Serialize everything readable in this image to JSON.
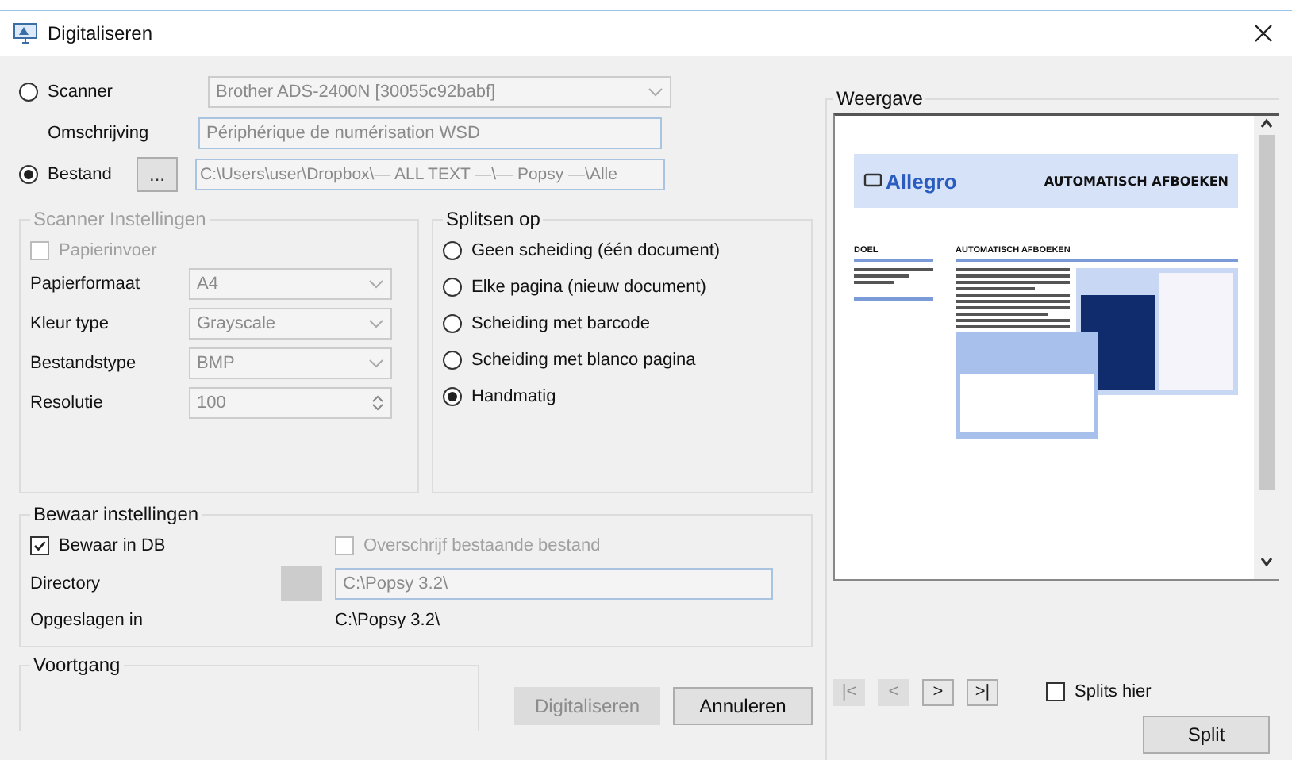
{
  "window": {
    "title": "Digitaliseren"
  },
  "scanner": {
    "label": "Scanner",
    "selected": false,
    "device": "Brother ADS-2400N [30055c92babf]"
  },
  "description": {
    "label": "Omschrijving",
    "value": "Périphérique de numérisation WSD"
  },
  "file": {
    "label": "Bestand",
    "selected": true,
    "browse": "...",
    "path": "C:\\Users\\user\\Dropbox\\— ALL TEXT —\\— Popsy —\\Alle"
  },
  "scanner_settings": {
    "title": "Scanner Instellingen",
    "disabled": true,
    "feeder": {
      "label": "Papierinvoer",
      "checked": false
    },
    "fields": [
      {
        "label": "Papierformaat",
        "value": "A4",
        "kind": "combo"
      },
      {
        "label": "Kleur type",
        "value": "Grayscale",
        "kind": "combo"
      },
      {
        "label": "Bestandstype",
        "value": "BMP",
        "kind": "combo"
      },
      {
        "label": "Resolutie",
        "value": "100",
        "kind": "spin"
      }
    ]
  },
  "split_on": {
    "title": "Splitsen op",
    "options": [
      {
        "label": "Geen scheiding (één document)",
        "selected": false
      },
      {
        "label": "Elke pagina (nieuw document)",
        "selected": false
      },
      {
        "label": "Scheiding met barcode",
        "selected": false
      },
      {
        "label": "Scheiding met blanco pagina",
        "selected": false
      },
      {
        "label": "Handmatig",
        "selected": true
      }
    ]
  },
  "save_settings": {
    "title": "Bewaar instellingen",
    "save_in_db": {
      "label": "Bewaar in DB",
      "checked": true
    },
    "overwrite": {
      "label": "Overschrijf bestaande bestand",
      "checked": false,
      "disabled": true
    },
    "directory": {
      "label": "Directory",
      "value": "C:\\Popsy 3.2\\"
    },
    "saved_in": {
      "label": "Opgeslagen in",
      "value": "C:\\Popsy 3.2\\"
    }
  },
  "progress": {
    "title": "Voortgang"
  },
  "buttons": [
    {
      "label": "Digitaliseren",
      "disabled": true
    },
    {
      "label": "Annuleren",
      "disabled": false
    }
  ],
  "preview": {
    "title": "Weergave",
    "document": {
      "brand": "Allegro",
      "header": "AUTOMATISCH AFBOEKEN",
      "sidebar_heading": "DOEL",
      "section_heading": "AUTOMATISCH AFBOEKEN"
    },
    "nav": [
      {
        "label": "|<",
        "disabled": true
      },
      {
        "label": "<",
        "disabled": true
      },
      {
        "label": ">",
        "disabled": false
      },
      {
        "label": ">|",
        "disabled": false
      }
    ],
    "split_here": {
      "label": "Splits hier",
      "checked": false
    },
    "split_button": "Split"
  }
}
